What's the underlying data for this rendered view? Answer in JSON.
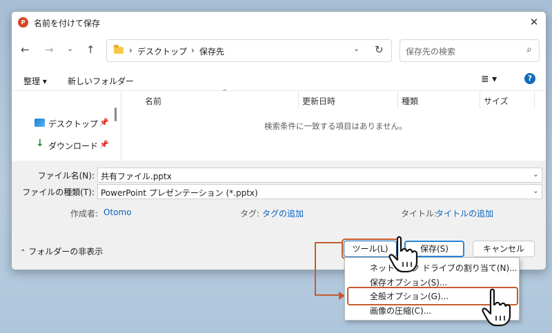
{
  "window": {
    "title": "名前を付けて保存",
    "app_icon": "P"
  },
  "nav": {
    "breadcrumb": [
      "デスクトップ",
      "保存先"
    ],
    "search_placeholder": "保存先の検索"
  },
  "toolbar": {
    "organize": "整理 ▾",
    "new_folder": "新しいフォルダー"
  },
  "sidebar": {
    "items": [
      {
        "label": "デスクトップ"
      },
      {
        "label": "ダウンロード"
      }
    ]
  },
  "columns": [
    "名前",
    "更新日時",
    "種類",
    "サイズ"
  ],
  "empty_message": "検索条件に一致する項目はありません。",
  "form": {
    "filename_label": "ファイル名(N):",
    "filename_value": "共有ファイル.pptx",
    "filetype_label": "ファイルの種類(T):",
    "filetype_value": "PowerPoint プレゼンテーション (*.pptx)",
    "author_label": "作成者:",
    "author_value": "Otomo",
    "tags_label": "タグ:",
    "tags_value": "タグの追加",
    "title_label": "タイトル:",
    "title_value": "タイトルの追加"
  },
  "footer": {
    "hide_folders": "フォルダーの非表示",
    "tools": "ツール(L)",
    "save": "保存(S)",
    "cancel": "キャンセル"
  },
  "tools_menu": {
    "items": [
      "ネットワーク ドライブの割り当て(N)...",
      "保存オプション(S)...",
      "全般オプション(G)...",
      "画像の圧縮(C)..."
    ]
  },
  "colors": {
    "accent": "#0f6cbd",
    "highlight": "#c65a2e",
    "link": "#0a62c2"
  }
}
